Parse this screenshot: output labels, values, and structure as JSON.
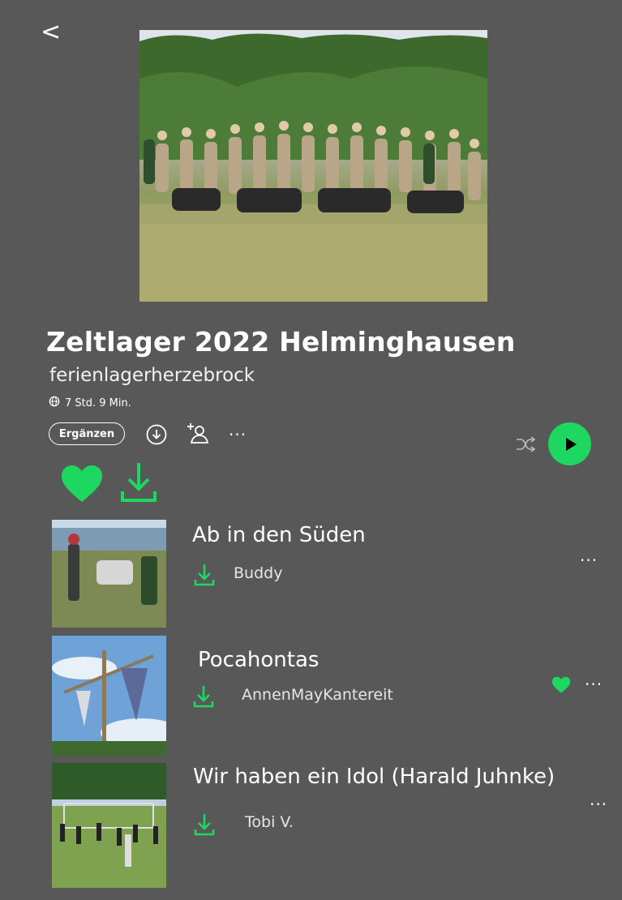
{
  "nav": {
    "back_label": "<"
  },
  "playlist": {
    "title": "Zeltlager 2022 Helminghausen",
    "owner": "ferienlagerherzebrock",
    "duration": "7 Std. 9 Min."
  },
  "actions": {
    "add_label": "Ergänzen",
    "more_label": "···"
  },
  "colors": {
    "accent": "#1ed760",
    "background": "#585858",
    "text": "#ffffff"
  },
  "tracks": [
    {
      "title": "Ab in den Süden",
      "artist": "Buddy",
      "liked": false,
      "more": "···"
    },
    {
      "title": "Pocahontas",
      "artist": "AnnenMayKantereit",
      "liked": true,
      "more": "···"
    },
    {
      "title": "Wir haben ein Idol (Harald Juhnke)",
      "artist": "Tobi V.",
      "liked": false,
      "more": "···"
    }
  ],
  "icons": [
    "back-icon",
    "globe-icon",
    "download-icon",
    "add-user-icon",
    "shuffle-icon",
    "play-icon",
    "heart-icon"
  ]
}
